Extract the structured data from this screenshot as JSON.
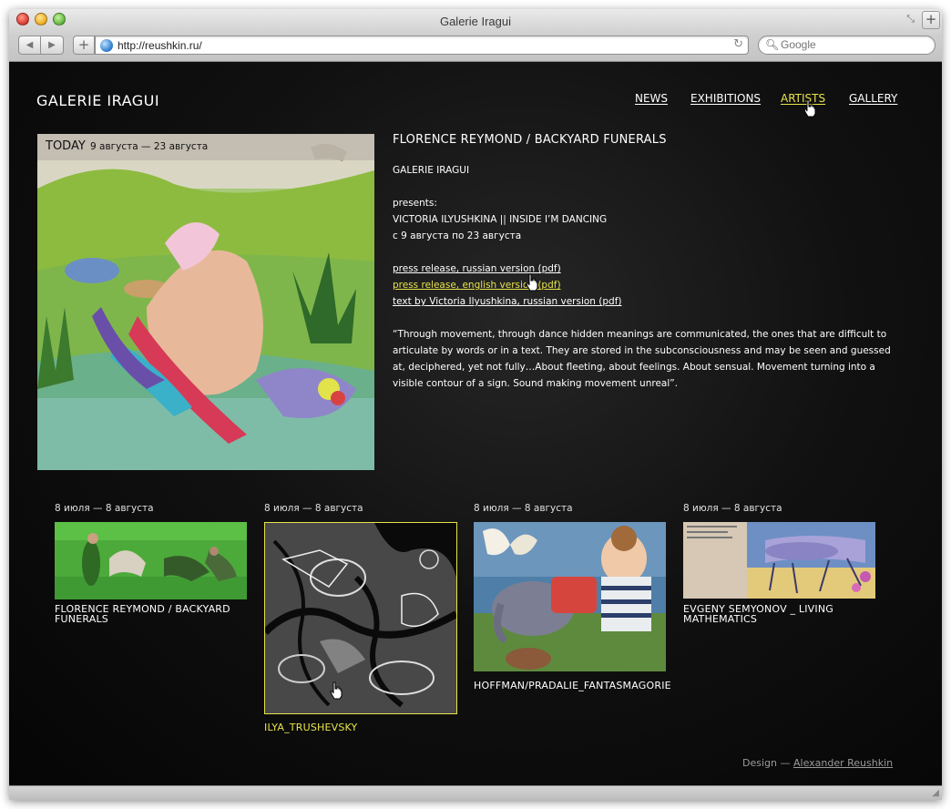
{
  "browser": {
    "window_title": "Galerie Iragui",
    "url": "http://reushkin.ru/",
    "search_placeholder": "Google"
  },
  "site": {
    "logo": "GALERIE IRAGUI",
    "nav": [
      {
        "label": "NEWS",
        "active": false
      },
      {
        "label": "EXHIBITIONS",
        "active": false
      },
      {
        "label": "ARTISTS",
        "active": true
      },
      {
        "label": "GALLERY",
        "active": false
      }
    ]
  },
  "hero": {
    "today_label": "TODAY",
    "today_dates": "9 августа — 23 августа"
  },
  "article": {
    "title": "FLORENCE REYMOND / BACKYARD FUNERALS",
    "gallery": "GALERIE IRAGUI",
    "presents": "presents:",
    "exhibition": "VICTORIA ILYUSHKINA || INSIDE I’M DANCING",
    "dates": "с 9 августа по 23 августа",
    "links": [
      "press release, russian version (pdf)",
      "press release, english version (pdf)",
      "text by Victoria Ilyushkina, russian version (pdf)"
    ],
    "quote": "“Through movement, through dance hidden meanings are communicated, the ones that are difficult to articulate by words or in a text. They are stored in the subconsciousness and may be seen and guessed at, deciphered, yet not fully…About fleeting, about feelings. About sensual. Movement turning into a visible contour of a sign. Sound making movement unreal”."
  },
  "cards": [
    {
      "date": "8 июля — 8 августа",
      "title": "FLORENCE REYMOND / BACKYARD FUNERALS"
    },
    {
      "date": "8 июля — 8 августа",
      "title": "ILYA_TRUSHEVSKY"
    },
    {
      "date": "8 июля — 8 августа",
      "title": "HOFFMAN/PRADALIE_FANTASMAGORIE"
    },
    {
      "date": "8 июля — 8 августа",
      "title": "EVGENY SEMYONOV _ LIVING MATHEMATICS"
    }
  ],
  "footer": {
    "prefix": "Design —",
    "author": "Alexander Reushkin"
  },
  "colors": {
    "accent": "#e8e34c",
    "background": "#0b0b0b",
    "text": "#ffffff"
  }
}
